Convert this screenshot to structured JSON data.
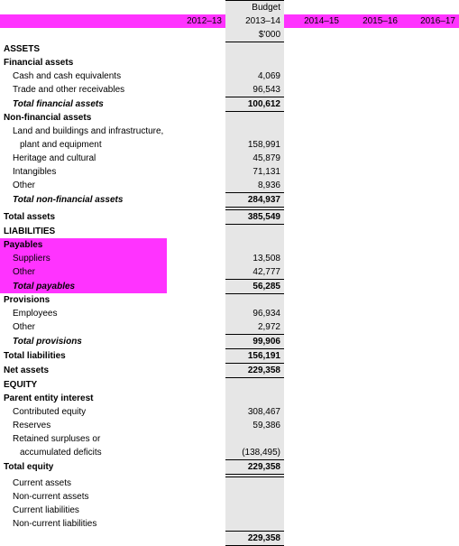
{
  "header": {
    "budget_label": "Budget",
    "years": {
      "y1": "2012–13",
      "y2": "2013–14",
      "y3": "2014–15",
      "y4": "2015–16",
      "y5": "2016–17"
    },
    "unit": "$'000"
  },
  "assets": {
    "section": "ASSETS",
    "financial": {
      "label": "Financial assets",
      "cash": {
        "label": "Cash and cash equivalents",
        "v": "4,069"
      },
      "receivables": {
        "label": "Trade and other receivables",
        "v": "96,543"
      },
      "total": {
        "label": "Total financial assets",
        "v": "100,612"
      }
    },
    "nonfinancial": {
      "label": "Non-financial assets",
      "lbi": {
        "label": "Land and buildings and infrastructure,",
        "label2": "plant and equipment",
        "v": "158,991"
      },
      "heritage": {
        "label": "Heritage and cultural",
        "v": "45,879"
      },
      "intangibles": {
        "label": "Intangibles",
        "v": "71,131"
      },
      "other": {
        "label": "Other",
        "v": "8,936"
      },
      "total": {
        "label": "Total non-financial assets",
        "v": "284,937"
      }
    },
    "total": {
      "label": "Total assets",
      "v": "385,549"
    }
  },
  "liabilities": {
    "section": "LIABILITIES",
    "payables": {
      "label": "Payables",
      "suppliers": {
        "label": "Suppliers",
        "v": "13,508"
      },
      "other": {
        "label": "Other",
        "v": "42,777"
      },
      "total": {
        "label": "Total payables",
        "v": "56,285"
      }
    },
    "provisions": {
      "label": "Provisions",
      "employee": {
        "label": "Employees",
        "v": "96,934"
      },
      "other": {
        "label": "Other",
        "v": "2,972"
      },
      "total": {
        "label": "Total provisions",
        "v": "99,906"
      }
    },
    "total": {
      "label": "Total liabilities",
      "v": "156,191"
    }
  },
  "netassets": {
    "label": "Net assets",
    "v": "229,358"
  },
  "equity": {
    "section": "EQUITY",
    "contributed": {
      "label": "Contributed equity",
      "v": "308,467"
    },
    "reserves": {
      "label": "Reserves",
      "v": "59,386"
    },
    "retained": {
      "label": "Retained surpluses or",
      "label2": "accumulated deficits",
      "v": "(138,495)"
    },
    "total": {
      "label": "Total equity",
      "v": "229,358"
    },
    "current": {
      "label": "Current assets",
      "label2": "Non-current assets",
      "label3": "Current liabilities",
      "label4": "Non-current liabilities"
    },
    "final": "229,358"
  }
}
